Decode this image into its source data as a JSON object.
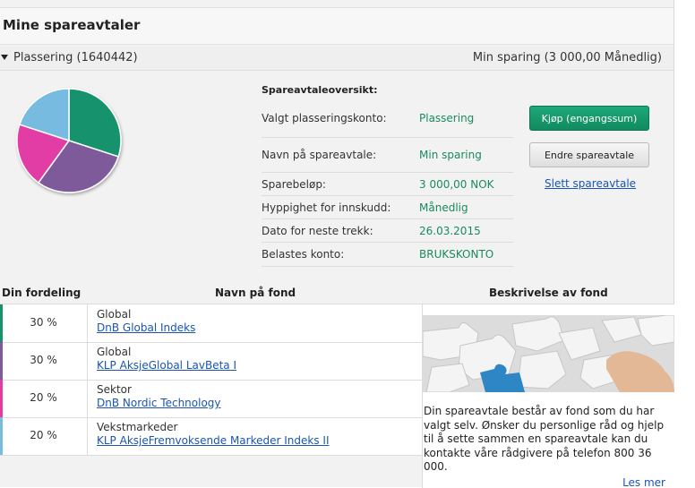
{
  "header": {
    "title": "Mine spareavtaler"
  },
  "plan_bar": {
    "account": "Plassering (1640442)",
    "plan": "Min sparing (3 000,00 Månedlig)"
  },
  "overview": {
    "heading": "Spareavtaleoversikt:",
    "rows": [
      {
        "label": "Valgt plasseringskonto:",
        "value": "Plassering"
      },
      {
        "label": "Navn på spareavtale:",
        "value": "Min sparing"
      },
      {
        "label": "Sparebeløp:",
        "value": "3 000,00 NOK"
      },
      {
        "label": "Hyppighet for innskudd:",
        "value": "Månedlig"
      },
      {
        "label": "Dato for neste trekk:",
        "value": "26.03.2015"
      },
      {
        "label": "Belastes konto:",
        "value": "BRUKSKONTO"
      }
    ]
  },
  "actions": {
    "buy": "Kjøp (engangssum)",
    "edit": "Endre spareavtale",
    "delete": "Slett spareavtale"
  },
  "table": {
    "headers": {
      "distribution": "Din fordeling",
      "fund": "Navn på fond",
      "description": "Beskrivelse av fond"
    },
    "rows": [
      {
        "percent": "30 %",
        "category": "Global",
        "fund": "DnB Global Indeks",
        "color": "#16936c"
      },
      {
        "percent": "30 %",
        "category": "Global",
        "fund": "KLP AksjeGlobal LavBeta I",
        "color": "#7e5a9b"
      },
      {
        "percent": "20 %",
        "category": "Sektor",
        "fund": "DnB Nordic Technology",
        "color": "#e23ca4"
      },
      {
        "percent": "20 %",
        "category": "Vekstmarkeder",
        "fund": "KLP AksjeFremvoksende Markeder Indeks II",
        "color": "#77bce0"
      }
    ]
  },
  "description": {
    "text": "Din spareavtale består av fond som du har valgt selv. Ønsker du personlige råd og hjelp til å sette sammen en spareavtale kan du kontakte våre rådgivere på telefon 800 36 000.",
    "more": "Les mer"
  }
}
